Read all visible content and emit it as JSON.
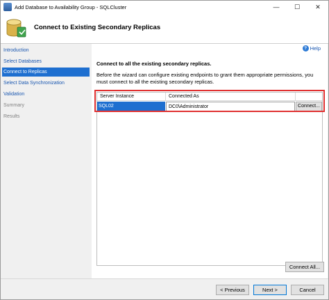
{
  "window": {
    "title": "Add Database to Availability Group - SQLCluster",
    "controls": {
      "minimize": "—",
      "maximize": "☐",
      "close": "✕"
    }
  },
  "header": {
    "title": "Connect to Existing Secondary Replicas"
  },
  "nav": {
    "items": [
      {
        "label": "Introduction",
        "state": "link"
      },
      {
        "label": "Select Databases",
        "state": "link"
      },
      {
        "label": "Connect to Replicas",
        "state": "active"
      },
      {
        "label": "Select Data Synchronization",
        "state": "link"
      },
      {
        "label": "Validation",
        "state": "link"
      },
      {
        "label": "Summary",
        "state": "disabled"
      },
      {
        "label": "Results",
        "state": "disabled"
      }
    ]
  },
  "content": {
    "help_label": "Help",
    "heading": "Connect to all the existing secondary replicas.",
    "description": "Before the wizard can configure existing endpoints to grant them appropriate permissions, you must connect to all the existing secondary replicas.",
    "grid": {
      "columns": [
        "Server Instance",
        "Connected As"
      ],
      "rows": [
        {
          "server": "SQL02",
          "connected_as": "DC0\\Administrator",
          "button": "Connect..."
        }
      ]
    },
    "connect_all_label": "Connect All..."
  },
  "footer": {
    "previous_label": "< Previous",
    "next_label": "Next >",
    "cancel_label": "Cancel"
  },
  "colors": {
    "selection": "#1e6fd0",
    "link": "#1a57b0",
    "highlight_outline": "#e03030"
  }
}
